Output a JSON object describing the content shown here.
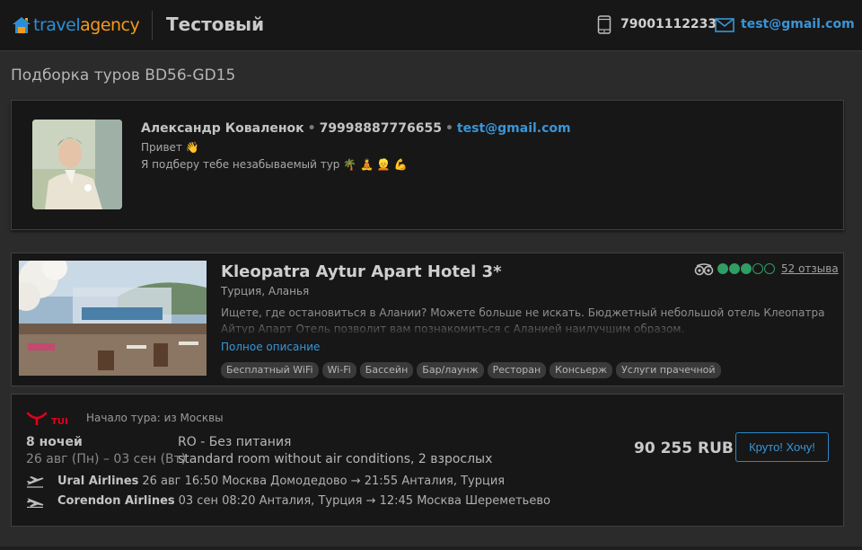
{
  "header": {
    "logo_part1": "travel",
    "logo_part2": "agency",
    "agency_name": "Тестовый",
    "phone": "79001112233",
    "email": "test@gmail.com"
  },
  "page": {
    "title": "Подборка туров BD56-GD15"
  },
  "agent": {
    "name": "Александр Коваленок",
    "phone": "79998887776655",
    "email": "test@gmail.com",
    "message_line1": "Привет 👋",
    "message_line2": "Я подберу тебе незабываемый тур 🌴 🧘 👱 💪"
  },
  "hotel": {
    "name": "Kleopatra Aytur Apart Hotel 3*",
    "location": "Турция, Аланья",
    "rating": 3,
    "rating_max": 5,
    "reviews": "52 отзыва",
    "description": "Ищете, где остановиться в Алании? Можете больше не искать. Бюджетный небольшой отель Клеопатра Айтур Апарт Отель позволит вам познакомиться с Аланией наилучшим образом.",
    "full_description_link": "Полное описание",
    "amenities": [
      "Бесплатный WiFi",
      "Wi-Fi",
      "Бассейн",
      "Бар/лаунж",
      "Ресторан",
      "Консьерж",
      "Услуги прачечной"
    ]
  },
  "offer": {
    "operator_logo": "TUI",
    "tour_start": "Начало тура: из Москвы",
    "nights": "8 ночей",
    "dates": "26 авг (Пн) – 03 сен (Вт)",
    "meal": "RO - Без питания",
    "room": "standard room without air conditions, 2 взрослых",
    "price": "90 255 RUB",
    "buy_button": "Круто! Хочу!",
    "flights": [
      {
        "airline": "Ural Airlines",
        "details": "26 авг 16:50 Москва Домодедово → 21:55 Анталия, Турция"
      },
      {
        "airline": "Corendon Airlines",
        "details": "03 сен 08:20 Анталия, Турция → 12:45 Москва Шереметьево"
      }
    ]
  },
  "colors": {
    "accent_blue": "#3a95d6",
    "logo_orange": "#f39a1e",
    "rating_green": "#2f9e63",
    "tui_red": "#e3001b"
  }
}
